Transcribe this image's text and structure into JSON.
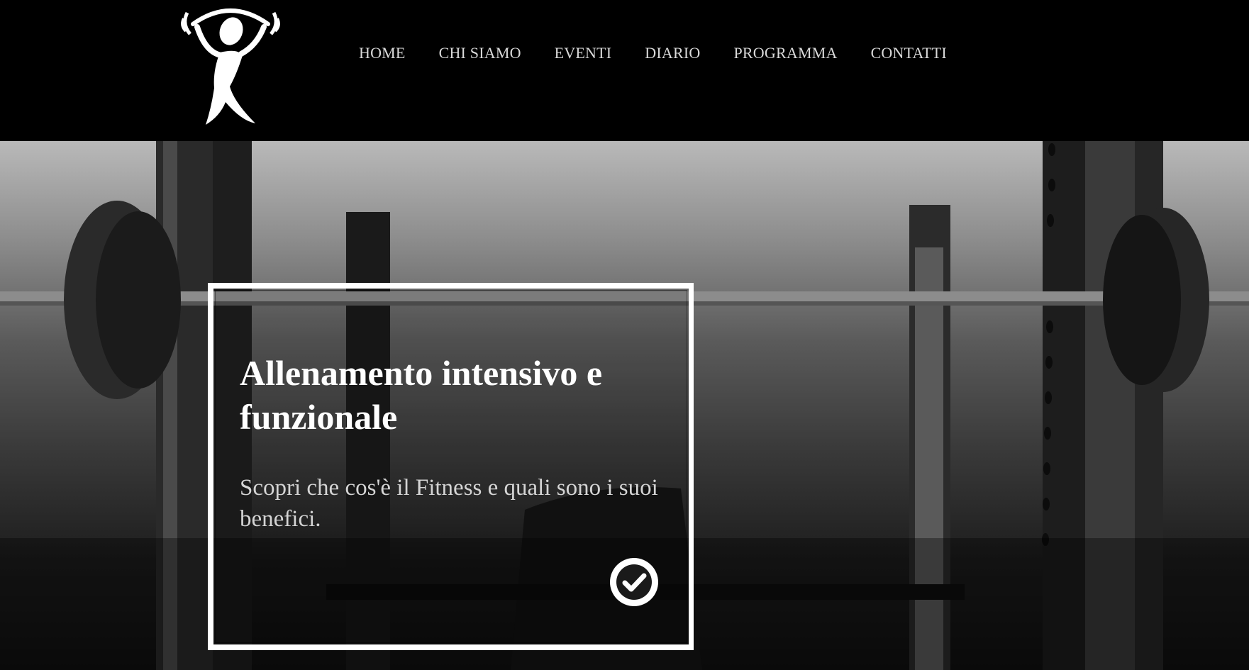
{
  "header": {
    "logo_icon": "weightlifter-logo",
    "nav": [
      {
        "label": "HOME",
        "name": "nav-home"
      },
      {
        "label": "CHI SIAMO",
        "name": "nav-chi-siamo"
      },
      {
        "label": "EVENTI",
        "name": "nav-eventi"
      },
      {
        "label": "DIARIO",
        "name": "nav-diario"
      },
      {
        "label": "PROGRAMMA",
        "name": "nav-programma"
      },
      {
        "label": "CONTATTI",
        "name": "nav-contatti"
      }
    ]
  },
  "hero": {
    "background": "gym-barbell-rack-photo",
    "card": {
      "title": "Allenamento intensivo e funzionale",
      "text": "Scopri che cos'è il Fitness e quali sono i suoi benefici.",
      "action_icon": "check-circle-icon"
    }
  },
  "colors": {
    "header_bg": "#000000",
    "nav_text": "#d9d9d9",
    "card_border": "#ffffff",
    "title": "#ffffff",
    "body_text": "#d4d4d4"
  }
}
